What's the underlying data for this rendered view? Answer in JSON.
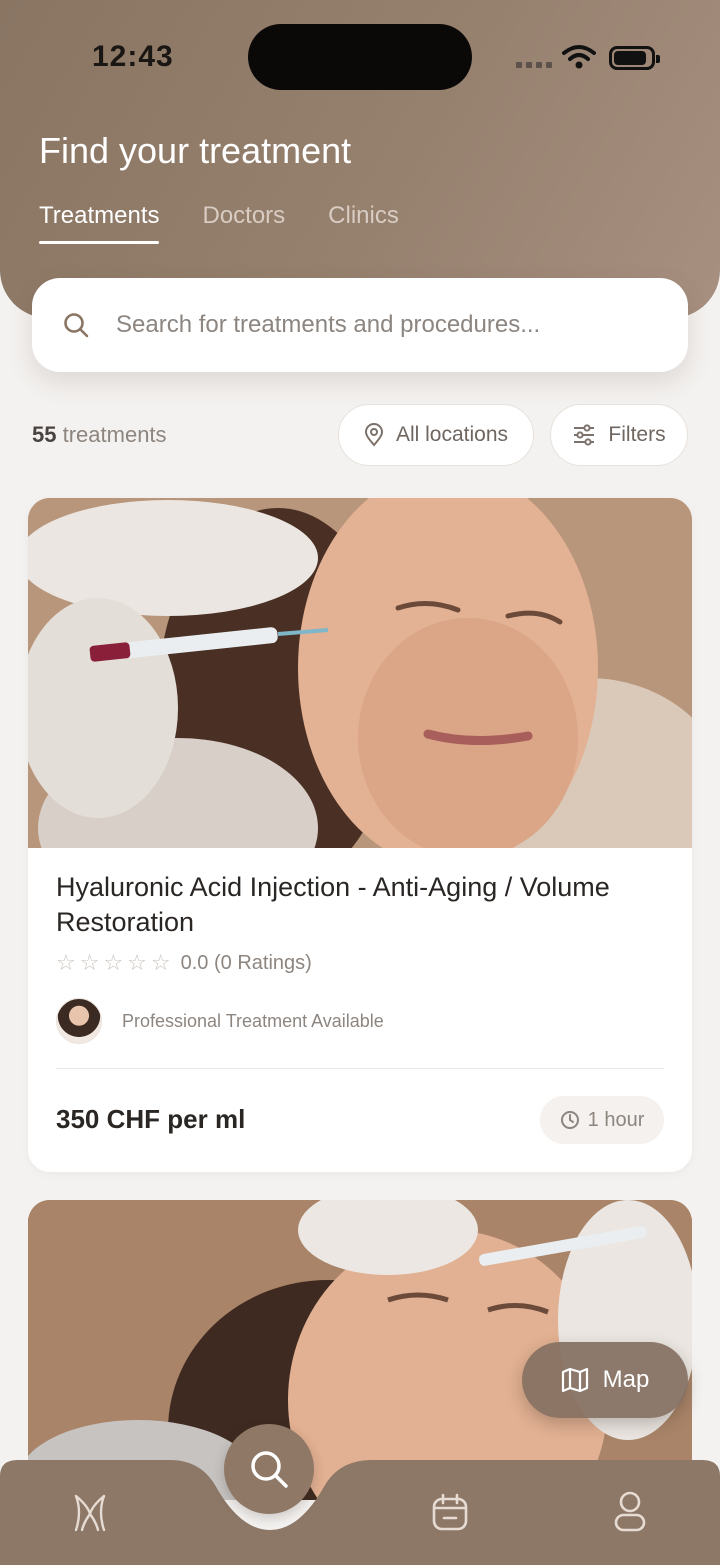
{
  "status_bar": {
    "time": "12:43"
  },
  "header": {
    "title": "Find your treatment",
    "tabs": [
      {
        "label": "Treatments",
        "active": true
      },
      {
        "label": "Doctors",
        "active": false
      },
      {
        "label": "Clinics",
        "active": false
      }
    ]
  },
  "search": {
    "placeholder": "Search for treatments and procedures...",
    "value": ""
  },
  "results": {
    "count": "55",
    "count_label": "treatments",
    "location_button": "All locations",
    "filters_button": "Filters"
  },
  "treatments": [
    {
      "title": "Hyaluronic Acid Injection - Anti-Aging / Volume Restoration",
      "stars": "☆☆☆☆☆",
      "rating_text": "0.0 (0 Ratings)",
      "provider_text": "Professional Treatment Available",
      "price": "350 CHF per ml",
      "duration": "1 hour"
    }
  ],
  "map_button": {
    "label": "Map"
  },
  "bottom_nav": {
    "items": [
      "home-icon",
      "search-icon",
      "calendar-icon",
      "profile-icon"
    ],
    "active": "search-icon"
  },
  "colors": {
    "header_brown": "#8a7563",
    "accent_brown": "#8f7866",
    "background": "#f4f2f0"
  }
}
